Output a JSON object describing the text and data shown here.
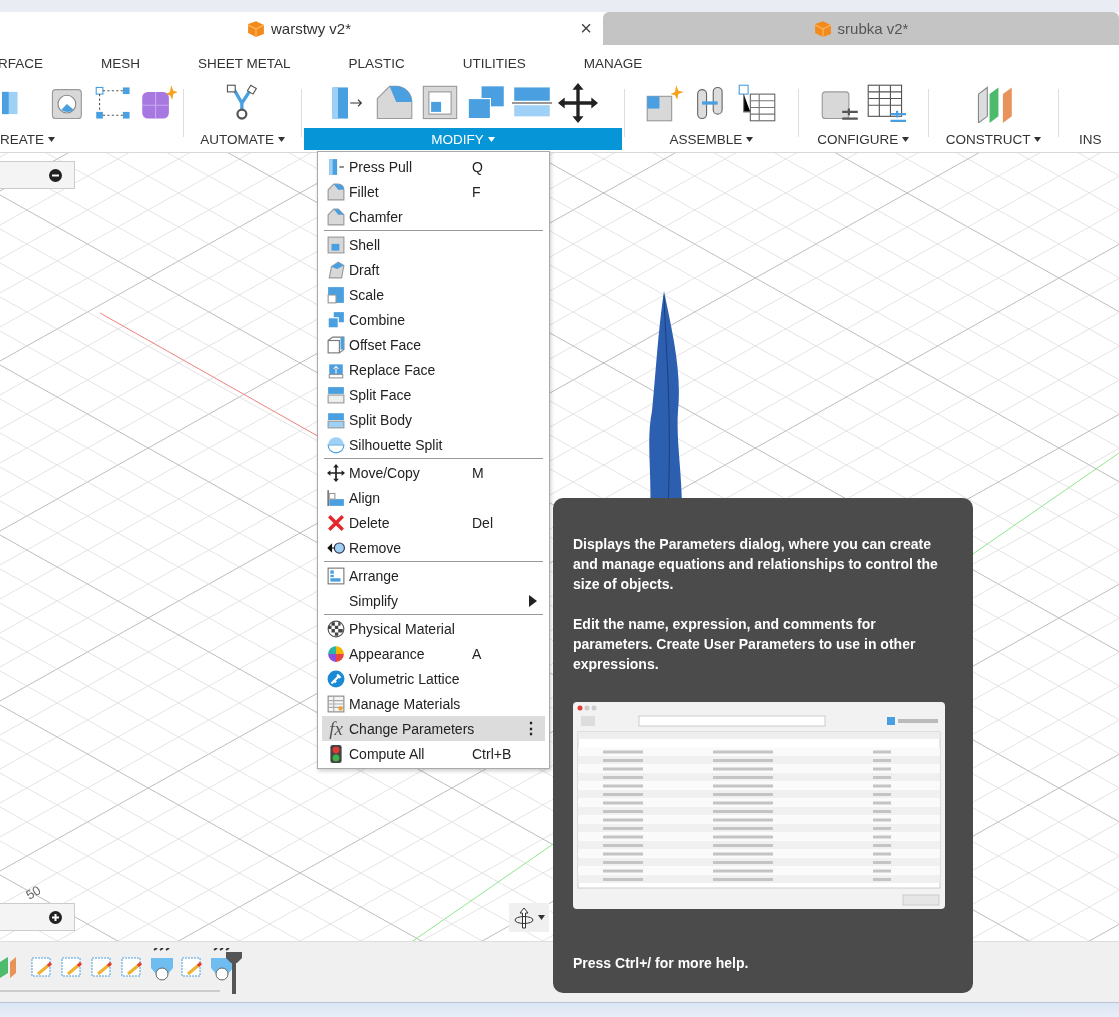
{
  "document_tabs": [
    {
      "label": "warstwy v2*",
      "selected": true,
      "close": "×"
    },
    {
      "label": "srubka v2*",
      "selected": false
    }
  ],
  "ribbon_tabs": [
    "RFACE",
    "MESH",
    "SHEET METAL",
    "PLASTIC",
    "UTILITIES",
    "MANAGE"
  ],
  "tool_groups": [
    {
      "label": "REATE",
      "selected": false
    },
    {
      "label": "AUTOMATE",
      "selected": false
    },
    {
      "label": "MODIFY",
      "selected": true
    },
    {
      "label": "ASSEMBLE",
      "selected": false
    },
    {
      "label": "CONFIGURE",
      "selected": false
    },
    {
      "label": "CONSTRUCT",
      "selected": false
    },
    {
      "label": "INS",
      "selected": false
    }
  ],
  "modify_menu": {
    "sections": [
      [
        {
          "label": "Press Pull",
          "shortcut": "Q"
        },
        {
          "label": "Fillet",
          "shortcut": "F"
        },
        {
          "label": "Chamfer"
        }
      ],
      [
        {
          "label": "Shell"
        },
        {
          "label": "Draft"
        },
        {
          "label": "Scale"
        },
        {
          "label": "Combine"
        },
        {
          "label": "Offset Face"
        },
        {
          "label": "Replace Face"
        },
        {
          "label": "Split Face"
        },
        {
          "label": "Split Body"
        },
        {
          "label": "Silhouette Split"
        }
      ],
      [
        {
          "label": "Move/Copy",
          "shortcut": "M"
        },
        {
          "label": "Align"
        },
        {
          "label": "Delete",
          "shortcut": "Del"
        },
        {
          "label": "Remove"
        }
      ],
      [
        {
          "label": "Arrange"
        },
        {
          "label": "Simplify",
          "submenu": true
        }
      ],
      [
        {
          "label": "Physical Material"
        },
        {
          "label": "Appearance",
          "shortcut": "A"
        },
        {
          "label": "Volumetric Lattice"
        },
        {
          "label": "Manage Materials"
        },
        {
          "label": "Change Parameters",
          "symbol": "fx",
          "selected": true,
          "more": "⋮"
        },
        {
          "label": "Compute All",
          "shortcut": "Ctrl+B"
        }
      ]
    ]
  },
  "viewport": {
    "axis_label": "50"
  },
  "tooltip": {
    "paragraphs": [
      "Displays the Parameters dialog, where you can create and manage equations and relationships to control the size of objects.",
      "Edit the name, expression, and comments for parameters. Create User Parameters to use in other expressions."
    ],
    "footer": "Press Ctrl+/ for more help."
  }
}
